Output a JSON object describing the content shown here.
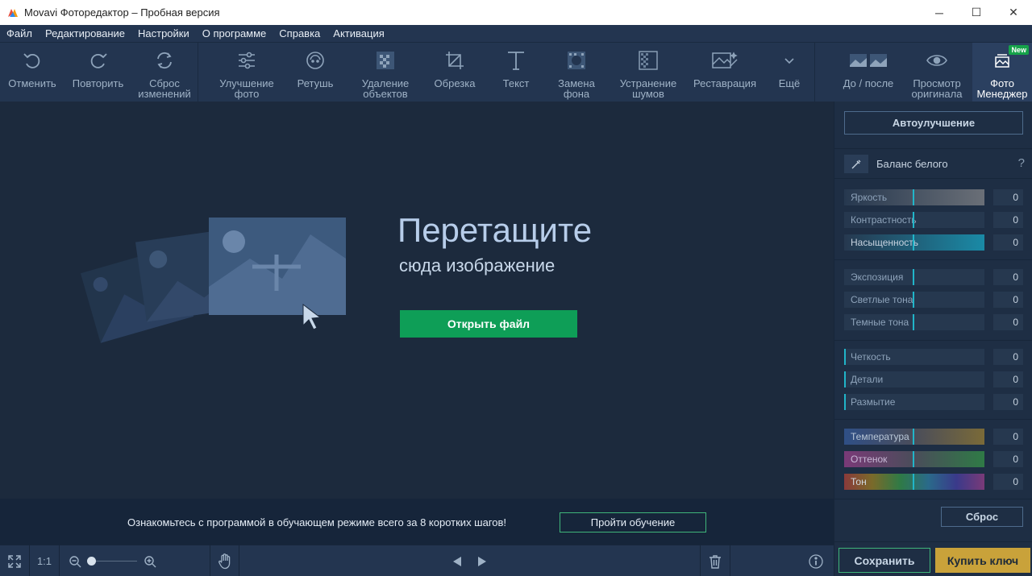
{
  "window": {
    "title": "Movavi Фоторедактор – Пробная версия",
    "controls": {
      "minimize": "─",
      "maximize": "☐",
      "close": "✕"
    }
  },
  "menu": [
    "Файл",
    "Редактирование",
    "Настройки",
    "О программе",
    "Справка",
    "Активация"
  ],
  "toolbar": {
    "undo": "Отменить",
    "redo": "Повторить",
    "reset": "Сброс изменений",
    "enhance": "Улучшение фото",
    "retouch": "Ретушь",
    "remove_objects": "Удаление объектов",
    "crop": "Обрезка",
    "text": "Текст",
    "replace_bg": "Замена фона",
    "denoise": "Устранение шумов",
    "restore": "Реставрация",
    "more": "Ещё",
    "before_after": "До / после",
    "view_original": "Просмотр оригинала",
    "photo_manager": "Фото Менеджер",
    "new_badge": "New"
  },
  "canvas": {
    "title": "Перетащите",
    "subtitle": "сюда изображение",
    "open_button": "Открыть файл"
  },
  "tutorial": {
    "text": "Ознакомьтесь с программой в обучающем режиме всего за 8 коротких шагов!",
    "button": "Пройти обучение"
  },
  "bottombar": {
    "one_to_one": "1:1"
  },
  "panel": {
    "auto_enhance": "Автоулучшение",
    "white_balance": "Баланс белого",
    "help": "?",
    "groups": [
      [
        {
          "label": "Яркость",
          "value": "0"
        },
        {
          "label": "Контрастность",
          "value": "0"
        },
        {
          "label": "Насыщенность",
          "value": "0"
        }
      ],
      [
        {
          "label": "Экспозиция",
          "value": "0"
        },
        {
          "label": "Светлые тона",
          "value": "0"
        },
        {
          "label": "Темные тона",
          "value": "0"
        }
      ],
      [
        {
          "label": "Четкость",
          "value": "0"
        },
        {
          "label": "Детали",
          "value": "0"
        },
        {
          "label": "Размытие",
          "value": "0"
        }
      ],
      [
        {
          "label": "Температура",
          "value": "0"
        },
        {
          "label": "Оттенок",
          "value": "0"
        },
        {
          "label": "Тон",
          "value": "0"
        }
      ]
    ],
    "reset": "Сброс",
    "save": "Сохранить",
    "buy": "Купить ключ"
  },
  "colors": {
    "accent_green": "#0e9e57",
    "accent_gold": "#c9a23a",
    "slider_marker": "#21b5c9",
    "background": "#1c2a3d"
  }
}
